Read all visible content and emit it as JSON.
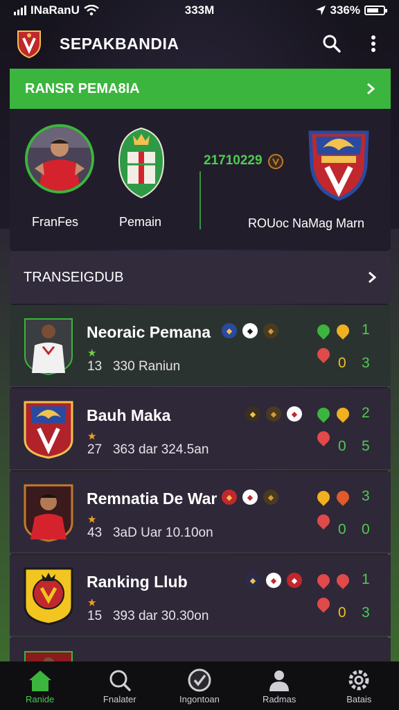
{
  "status_bar": {
    "carrier": "INaRanU",
    "time": "333M",
    "battery": "336%"
  },
  "header": {
    "title": "SEPAKBANDIA",
    "icons": [
      "club-crest-logo",
      "search-icon",
      "more-vert-icon"
    ]
  },
  "banner": {
    "label": "RANSR PEMA8IA"
  },
  "featured": {
    "items": [
      {
        "label": "FranFes",
        "kind": "player-avatar"
      },
      {
        "label": "Pemain",
        "kind": "green-shield"
      }
    ],
    "date": "21710229",
    "right_label": "ROUoc NaMag Marn"
  },
  "section": {
    "title": "TRANSEIGDUB"
  },
  "rows": [
    {
      "name": "Neoraic Pemana",
      "rank": "13",
      "meta": "330 Raniun",
      "score_top": "1",
      "score_left": "0",
      "score_right": "3",
      "star_color": "#6fd14a"
    },
    {
      "name": "Bauh Maka",
      "rank": "27",
      "meta": "363 dar 324.5an",
      "score_top": "2",
      "score_left": "0",
      "score_right": "5",
      "star_color": "#f0a020"
    },
    {
      "name": "Remnatia De War",
      "rank": "43",
      "meta": "3aD Uar 10.10on",
      "score_top": "3",
      "score_left": "0",
      "score_right": "0",
      "star_color": "#f0a020"
    },
    {
      "name": "Ranking Llub",
      "rank": "15",
      "meta": "393 dar 30.30on",
      "score_top": "1",
      "score_left": "0",
      "score_right": "3",
      "star_color": "#f0a020"
    }
  ],
  "nav": [
    {
      "label": "Ranide",
      "icon": "home-icon",
      "active": true
    },
    {
      "label": "Fnalater",
      "icon": "search-icon",
      "active": false
    },
    {
      "label": "Ingontoan",
      "icon": "check-badge-icon",
      "active": false
    },
    {
      "label": "Radmas",
      "icon": "person-icon",
      "active": false
    },
    {
      "label": "Batais",
      "icon": "gear-icon",
      "active": false
    }
  ],
  "colors": {
    "accent": "#3bb53e",
    "background": "#1b1722",
    "panel": "#2f2838",
    "score_green": "#4ecb52",
    "score_yellow": "#f0c020"
  }
}
